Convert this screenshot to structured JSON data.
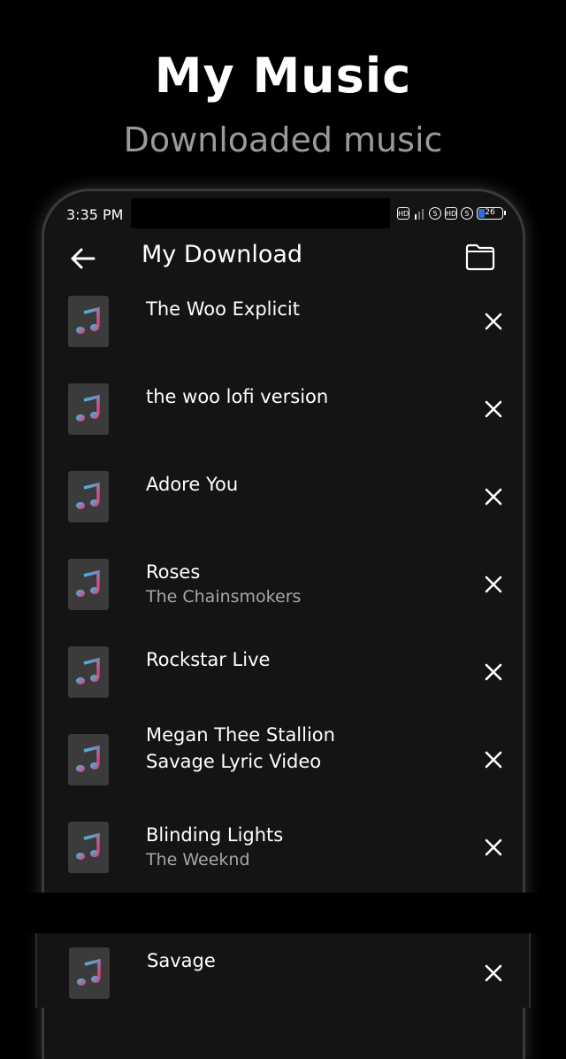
{
  "promo": {
    "title": "My Music",
    "subtitle": "Downloaded music"
  },
  "status_bar": {
    "time": "3:35 PM",
    "battery_level": "26",
    "battery_fraction": 0.26,
    "icons": [
      "hd-icon",
      "signal-icon",
      "sim-5g-icon",
      "hd-icon",
      "sim-5g-icon",
      "battery-icon"
    ]
  },
  "app_bar": {
    "title": "My Download",
    "back_icon": "arrow-left-icon",
    "folder_icon": "folder-icon"
  },
  "songs": [
    {
      "title": "The Woo Explicit",
      "artist": ""
    },
    {
      "title": "the woo lofi version",
      "artist": ""
    },
    {
      "title": "Adore You",
      "artist": ""
    },
    {
      "title": "Roses",
      "artist": "The Chainsmokers"
    },
    {
      "title": "Rockstar Live",
      "artist": ""
    },
    {
      "title": "Megan Thee Stallion",
      "title_line2": "Savage Lyric Video",
      "artist": ""
    },
    {
      "title": "Blinding Lights",
      "artist": "The Weeknd"
    },
    {
      "title": "Savage",
      "artist": ""
    }
  ],
  "colors": {
    "background": "#000000",
    "surface": "#141414",
    "thumb": "#3b3b3b",
    "note_gradient_start": "#2ec6f0",
    "note_gradient_end": "#f0336b"
  }
}
